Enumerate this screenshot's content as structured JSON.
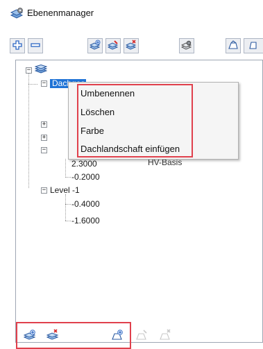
{
  "window": {
    "title": "Ebenenmanager",
    "icon": "layer-manager-icon"
  },
  "toolbar": {
    "buttons": [
      {
        "name": "add-item-button",
        "icon": "plus-icon"
      },
      {
        "name": "remove-item-button",
        "icon": "minus-icon"
      },
      {
        "name": "new-layer-button",
        "icon": "layer-add-icon"
      },
      {
        "name": "edit-layer-button",
        "icon": "layer-edit-icon"
      },
      {
        "name": "delete-layer-button",
        "icon": "layer-delete-icon"
      },
      {
        "name": "layer-settings-button",
        "icon": "layer-settings-icon"
      },
      {
        "name": "roof-button",
        "icon": "roof-icon"
      },
      {
        "name": "roof-extra-button",
        "icon": "roof-extra-icon"
      }
    ]
  },
  "tree": {
    "root_icon": "layer-stack-icon",
    "selected_label": "Dachgeschoss",
    "partial_labels": {
      "mid_value": "2.3000",
      "basis_label": "HV-Basis"
    },
    "level_minus1_neighbors": [
      "-0.2000"
    ],
    "level_minus1": {
      "label": "Level -1",
      "children": [
        "-0.4000",
        "-1.6000"
      ]
    }
  },
  "context_menu": {
    "items": [
      "Umbenennen",
      "Löschen",
      "Farbe",
      "Dachlandschaft einfügen"
    ]
  },
  "colors": {
    "selection": "#1f73d6",
    "highlight_red": "#e0404c",
    "icon_blue": "#2b66c4",
    "icon_red": "#d62b2b"
  }
}
